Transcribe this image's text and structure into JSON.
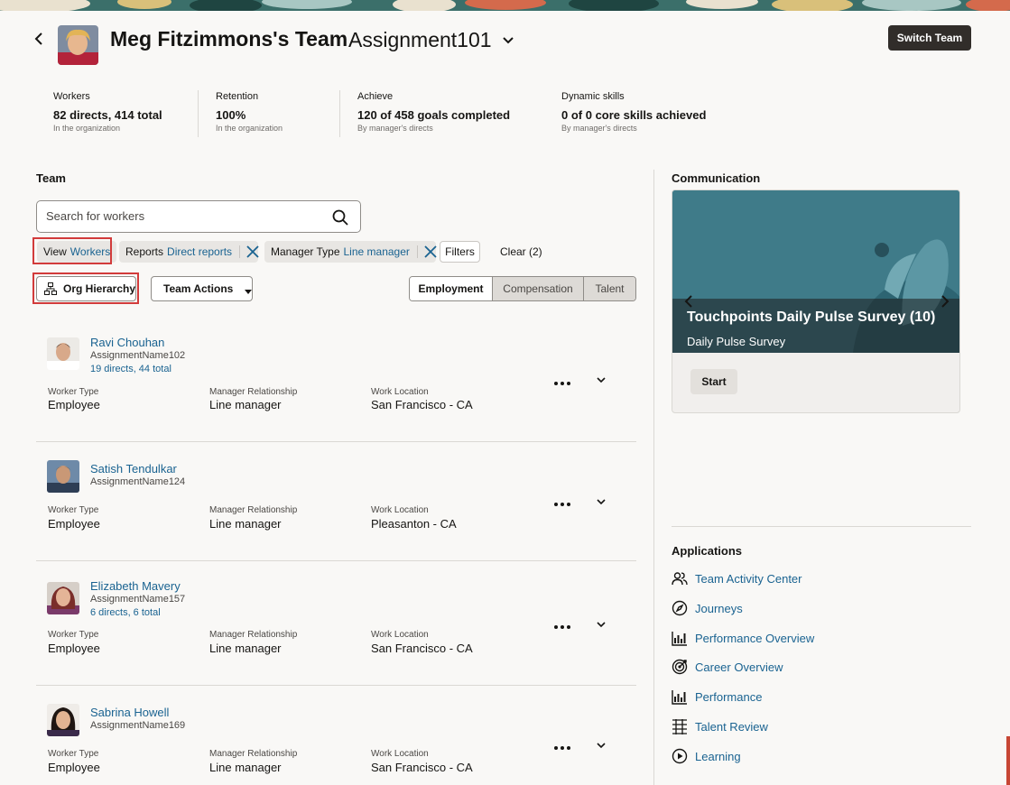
{
  "header": {
    "team_title": "Meg Fitzimmons's Team",
    "assignment_title": "Assignment101",
    "switch_team_label": "Switch Team"
  },
  "metrics": [
    {
      "label": "Workers",
      "value": "82 directs, 414 total",
      "sub": "In the organization"
    },
    {
      "label": "Retention",
      "value": "100%",
      "sub": "In the organization"
    },
    {
      "label": "Achieve",
      "value": "120 of 458 goals completed",
      "sub": "By manager's directs"
    },
    {
      "label": "Dynamic skills",
      "value": "0 of 0 core skills achieved",
      "sub": "By manager's directs"
    }
  ],
  "team": {
    "section_title": "Team",
    "search_placeholder": "Search for workers",
    "chips": [
      {
        "key": "View",
        "value": "Workers"
      },
      {
        "key": "Reports",
        "value": "Direct reports"
      },
      {
        "key": "Manager Type",
        "value": "Line manager"
      }
    ],
    "filters_label": "Filters",
    "clear_label": "Clear (2)",
    "org_hierarchy_label": "Org Hierarchy",
    "team_actions_label": "Team Actions",
    "tabs": [
      "Employment",
      "Compensation",
      "Talent"
    ],
    "field_labels": {
      "worker_type": "Worker Type",
      "manager_relationship": "Manager Relationship",
      "work_location": "Work Location"
    },
    "workers": [
      {
        "name": "Ravi Chouhan",
        "assignment": "AssignmentName102",
        "directs": "19 directs, 44 total",
        "worker_type": "Employee",
        "manager_relationship": "Line manager",
        "work_location": "San Francisco - CA"
      },
      {
        "name": "Satish Tendulkar",
        "assignment": "AssignmentName124",
        "directs": "",
        "worker_type": "Employee",
        "manager_relationship": "Line manager",
        "work_location": "Pleasanton - CA"
      },
      {
        "name": "Elizabeth Mavery",
        "assignment": "AssignmentName157",
        "directs": "6 directs, 6 total",
        "worker_type": "Employee",
        "manager_relationship": "Line manager",
        "work_location": "San Francisco - CA"
      },
      {
        "name": "Sabrina Howell",
        "assignment": "AssignmentName169",
        "directs": "",
        "worker_type": "Employee",
        "manager_relationship": "Line manager",
        "work_location": "San Francisco - CA"
      }
    ]
  },
  "communication": {
    "section_title": "Communication",
    "card_title": "Touchpoints Daily Pulse Survey (10)",
    "card_subtitle": "Daily Pulse Survey",
    "start_label": "Start"
  },
  "applications": {
    "section_title": "Applications",
    "items": [
      {
        "label": "Team Activity Center",
        "icon": "people-icon"
      },
      {
        "label": "Journeys",
        "icon": "compass-icon"
      },
      {
        "label": "Performance Overview",
        "icon": "chart-icon"
      },
      {
        "label": "Career Overview",
        "icon": "target-icon"
      },
      {
        "label": "Performance",
        "icon": "chart-icon"
      },
      {
        "label": "Talent Review",
        "icon": "grid-icon"
      },
      {
        "label": "Learning",
        "icon": "play-circle-icon"
      }
    ]
  },
  "colors": {
    "link": "#1a6391",
    "primary_button": "#312d2a",
    "highlight_box": "#d23b3b"
  }
}
